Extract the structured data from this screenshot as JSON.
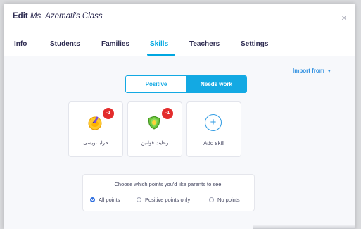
{
  "dialog": {
    "title_prefix": "Edit",
    "title_class": "Ms. Azemati's Class",
    "close_glyph": "×"
  },
  "tabs": [
    {
      "label": "Info",
      "active": false
    },
    {
      "label": "Students",
      "active": false
    },
    {
      "label": "Families",
      "active": false
    },
    {
      "label": "Skills",
      "active": true
    },
    {
      "label": "Teachers",
      "active": false
    },
    {
      "label": "Settings",
      "active": false
    }
  ],
  "import_label": "Import from",
  "toggle": {
    "positive": "Positive",
    "needs_work": "Needs work",
    "selected": "Needs work"
  },
  "skills": [
    {
      "label": "خرابا نویسی",
      "badge": "-1",
      "icon": "pencil-hand-icon"
    },
    {
      "label": "رعایت قوانین",
      "badge": "-1",
      "icon": "shield-icon"
    }
  ],
  "add_skill": {
    "label": "Add skill",
    "glyph": "+"
  },
  "points": {
    "question": "Choose which points you'd like parents to see:",
    "options": [
      "All points",
      "Positive points only",
      "No points"
    ],
    "selected": "All points"
  },
  "colors": {
    "accent": "#13a9e3",
    "badge": "#e32c2c",
    "link": "#2e8fe0"
  }
}
